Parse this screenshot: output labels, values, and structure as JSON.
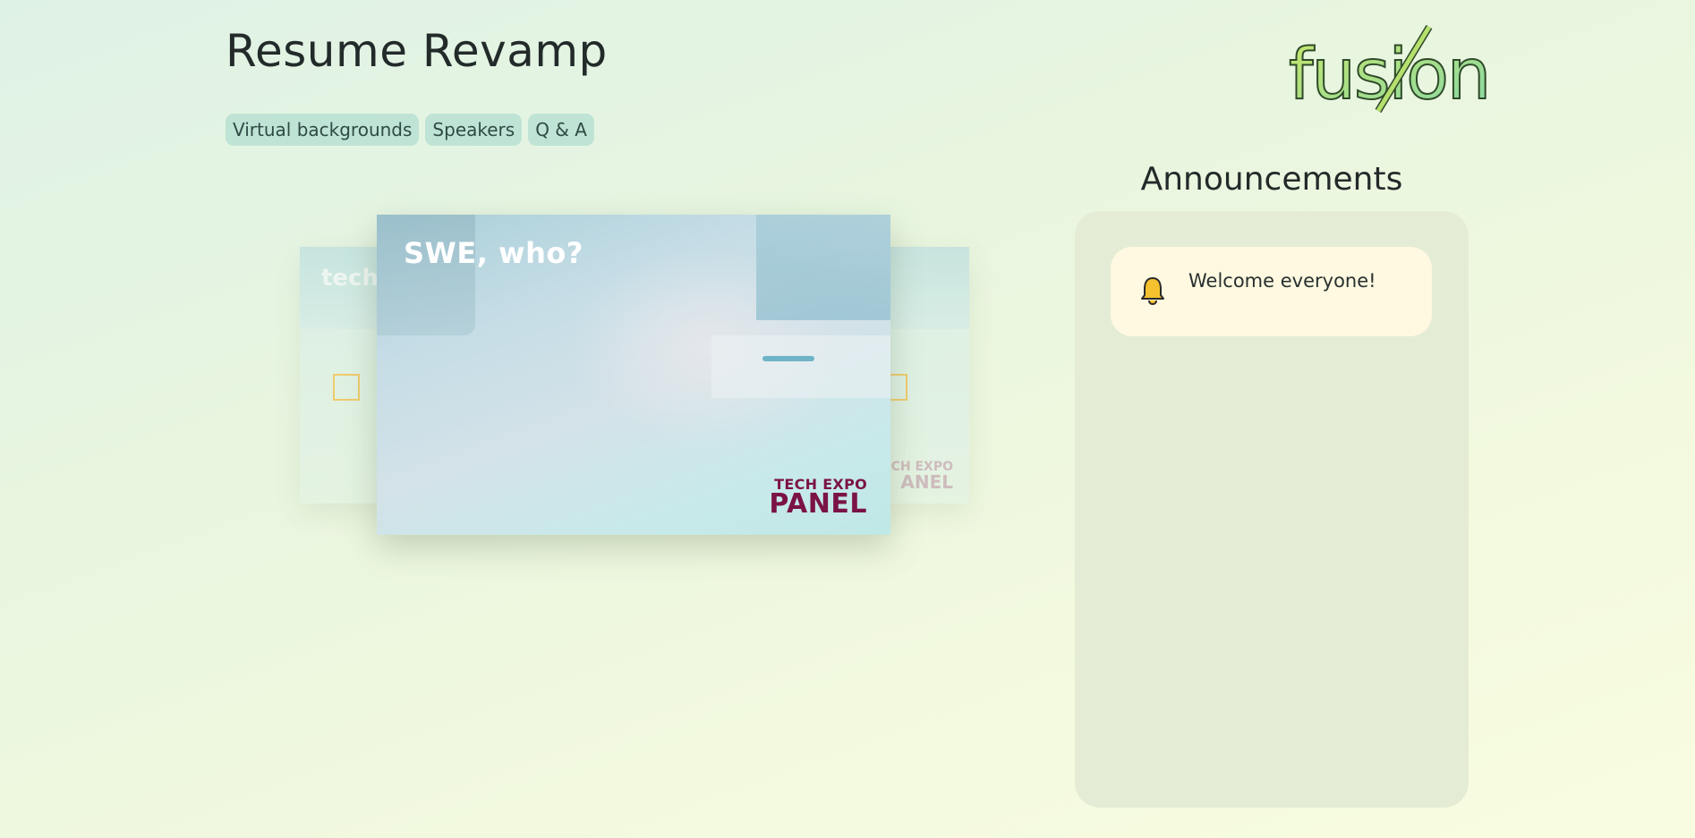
{
  "header": {
    "title": "Resume Revamp"
  },
  "tabs": [
    {
      "label": "Virtual backgrounds"
    },
    {
      "label": "Speakers"
    },
    {
      "label": "Q & A"
    }
  ],
  "logo": {
    "text": "fusion",
    "icon": "fusion-logo",
    "color_start": "#c8e66a",
    "color_end": "#86d8a8"
  },
  "carousel": {
    "main_slide": {
      "title": "SWE, who?",
      "logo_line1": "TECH EXPO",
      "logo_line2": "PANEL"
    },
    "left_slide": {
      "title": "tech"
    },
    "right_slide": {
      "logo_line1": "CH EXPO",
      "logo_line2": "ANEL"
    }
  },
  "announcements": {
    "title": "Announcements",
    "items": [
      {
        "icon": "bell-icon",
        "text": "Welcome everyone!"
      }
    ]
  },
  "colors": {
    "tab_bg": "#bfe4d6",
    "panel_bg": "#e5ecd5",
    "card_bg": "#fef9e0",
    "bell": "#f5c12e",
    "brand_logo": "#7b1346"
  }
}
